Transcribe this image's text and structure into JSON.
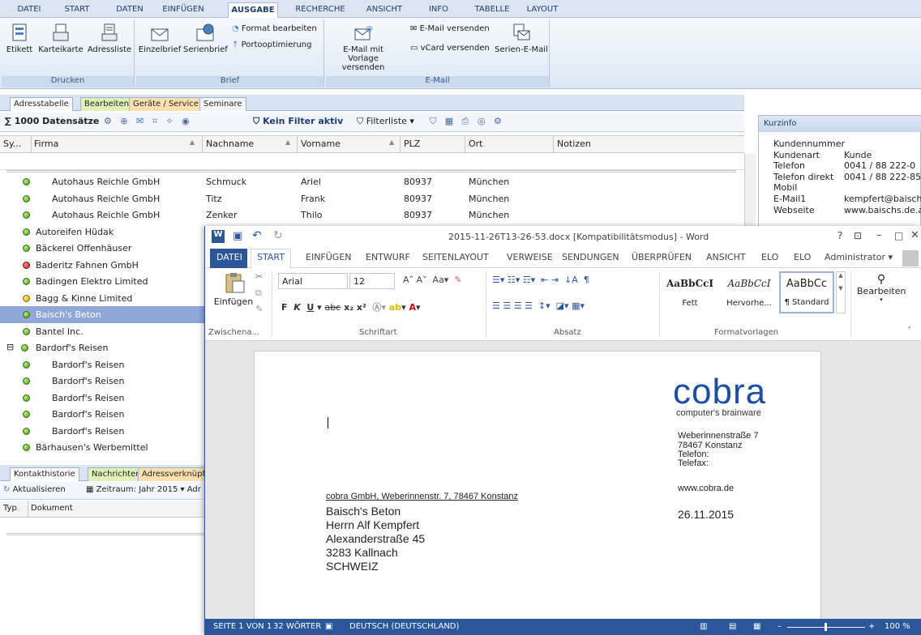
{
  "ribbon_tabs": [
    "DATEI",
    "START",
    "DATEN",
    "EINFÜGEN",
    "AUSGABE",
    "RECHERCHE",
    "ANSICHT",
    "INFO",
    "TABELLE",
    "LAYOUT"
  ],
  "ribbon": {
    "drucken": {
      "label": "Drucken",
      "btn1": "Etikett",
      "btn2": "Karteikarte",
      "btn3": "Adressliste"
    },
    "brief": {
      "label": "Brief",
      "btn1": "Einzelbrief",
      "btn2": "Serienbrief",
      "format": "Format bearbeiten",
      "porto": "Portooptimierung"
    },
    "email": {
      "label": "E-Mail",
      "vorlage1": "E-Mail mit",
      "vorlage2": "Vorlage versenden",
      "send": "E-Mail versenden",
      "vcard": "vCard versenden",
      "serien": "Serien-E-Mail"
    }
  },
  "data_tabs": [
    "Adresstabelle",
    "Bearbeiten",
    "Geräte / Service",
    "Seminare"
  ],
  "toolbar": {
    "count": "1000 Datensätze",
    "filter": "Kein Filter aktiv",
    "filterliste": "Filterliste"
  },
  "columns": [
    "Sy...",
    "Firma",
    "Nachname",
    "Vorname",
    "PLZ",
    "Ort",
    "Notizen"
  ],
  "rows": [
    {
      "firma": "Autohaus Reichle GmbH",
      "nachname": "Schmuck",
      "vorname": "Ariel",
      "plz": "80937",
      "ort": "München",
      "status": "green",
      "indent": true
    },
    {
      "firma": "Autohaus Reichle GmbH",
      "nachname": "Titz",
      "vorname": "Frank",
      "plz": "80937",
      "ort": "München",
      "status": "green",
      "indent": true
    },
    {
      "firma": "Autohaus Reichle GmbH",
      "nachname": "Zenker",
      "vorname": "Thilo",
      "plz": "80937",
      "ort": "München",
      "status": "green",
      "indent": true
    },
    {
      "firma": "Autoreifen Hüdak",
      "status": "green"
    },
    {
      "firma": "Bäckerei Offenhäuser",
      "status": "green"
    },
    {
      "firma": "Baderitz Fahnen GmbH",
      "status": "red"
    },
    {
      "firma": "Badingen Elektro Limited",
      "status": "green"
    },
    {
      "firma": "Bagg & Kinne Limited",
      "status": "yellow"
    },
    {
      "firma": "Baisch's Beton",
      "status": "green",
      "selected": true
    },
    {
      "firma": "Bantel Inc.",
      "status": "green"
    },
    {
      "firma": "Bardorf's Reisen",
      "status": "green",
      "expander": "⊟"
    },
    {
      "firma": "Bardorf's Reisen",
      "status": "green",
      "indent": true
    },
    {
      "firma": "Bardorf's Reisen",
      "status": "green",
      "indent": true
    },
    {
      "firma": "Bardorf's Reisen",
      "status": "green",
      "indent": true
    },
    {
      "firma": "Bardorf's Reisen",
      "status": "green",
      "indent": true
    },
    {
      "firma": "Bardorf's Reisen",
      "status": "green",
      "indent": true
    },
    {
      "firma": "Bärhausen's Werbemittel",
      "status": "green"
    }
  ],
  "bottom_tabs": [
    "Kontakthistorie",
    "Nachrichten",
    "Adressverknüpfu"
  ],
  "bottom_toolbar": {
    "refresh": "Aktualisieren",
    "zeitraum": "Zeitraum: Jahr 2015 ▾ Adr"
  },
  "bottom_columns": [
    "Typ",
    "Dokument"
  ],
  "kurzinfo": {
    "title": "Kurzinfo",
    "rows": [
      {
        "label": "Kundennummer",
        "value": ""
      },
      {
        "label": "Kundenart",
        "value": "Kunde"
      },
      {
        "label": "Telefon",
        "value": "0041 / 88 222-0"
      },
      {
        "label": "Telefon direkt",
        "value": "0041 / 88 222-85"
      },
      {
        "label": "Mobil",
        "value": ""
      },
      {
        "label": "E-Mail1",
        "value": "kempfert@baischs"
      },
      {
        "label": "Webseite",
        "value": "www.baischs.de.a"
      }
    ]
  },
  "word": {
    "title": "2015-11-26T13-26-53.docx [Kompatibilitätsmodus] - Word",
    "tabs": [
      "DATEI",
      "START",
      "EINFÜGEN",
      "ENTWURF",
      "SEITENLAYOUT",
      "VERWEISE",
      "SENDUNGEN",
      "ÜBERPRÜFEN",
      "ANSICHT",
      "ELO",
      "ELO"
    ],
    "user": "Administrator ▾",
    "font": "Arial",
    "size": "12",
    "paste": "Einfügen",
    "groups": [
      "Zwischena...",
      "Schriftart",
      "Absatz",
      "Formatvorlagen"
    ],
    "styles": [
      {
        "preview": "AaBbCcI",
        "name": "Fett"
      },
      {
        "preview": "AaBbCcI",
        "name": "Hervorhe..."
      },
      {
        "preview": "AaBbCc",
        "name": "¶ Standard"
      }
    ],
    "edit": "Bearbeiten",
    "status": {
      "page": "SEITE 1 VON 1",
      "words": "32 WÖRTER",
      "lang": "DEUTSCH (DEUTSCHLAND)",
      "zoom": "100 %"
    }
  },
  "letter": {
    "logo": "cobra",
    "tagline": "computer's brainware",
    "addr1": "Weberinnenstraße 7",
    "addr2": "78467 Konstanz",
    "tel": "Telefon:",
    "fax": "Telefax:",
    "web": "www.cobra.de",
    "sender": "cobra GmbH, Weberinnenstr. 7, 78467 Konstanz",
    "recipient": [
      "Baisch's Beton",
      "Herrn Alf Kempfert",
      "Alexanderstraße 45",
      "3283 Kallnach",
      "SCHWEIZ"
    ],
    "date": "26.11.2015"
  },
  "colors": {
    "accent": "#2b579a",
    "selection": "#8fa8d8",
    "cobra_blue": "#1c4fa0"
  }
}
